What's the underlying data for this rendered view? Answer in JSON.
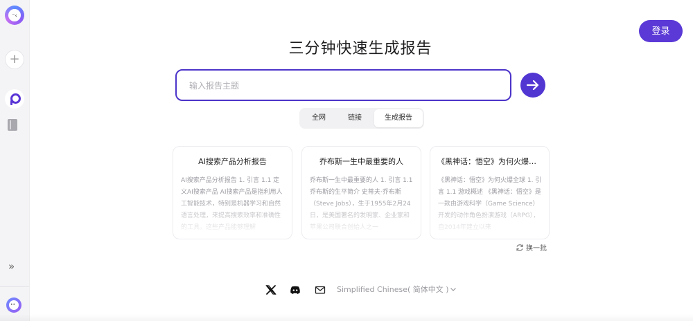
{
  "sidebar": {
    "logo_icon": "chat-logo-icon",
    "new_chat_icon": "plus-icon",
    "search_icon": "search-logo-icon",
    "library_icon": "book-icon",
    "expand_icon": "double-chevron-right-icon",
    "avatar_icon": "avatar-icon"
  },
  "header": {
    "login_label": "登录"
  },
  "main": {
    "title": "三分钟快速生成报告",
    "search": {
      "placeholder": "输入报告主题",
      "value": ""
    },
    "tabs": [
      {
        "label": "全网",
        "active": false
      },
      {
        "label": "链接",
        "active": false
      },
      {
        "label": "生成报告",
        "active": true
      }
    ],
    "cards": [
      {
        "title": "AI搜索产品分析报告",
        "body": "AI搜索产品分析报告 1. 引言 1.1 定义AI搜索产品 AI搜索产品是指利用人工智能技术，特别是机器学习和自然语言处理，来提高搜索效率和准确性的工具。这些产品能够理解"
      },
      {
        "title": "乔布斯一生中最重要的人",
        "body": "乔布斯一生中最重要的人 1. 引言 1.1 乔布斯的生平简介 史蒂夫·乔布斯（Steve Jobs），生于1955年2月24日，是美国著名的发明家、企业家和苹果公司联合创始人之一"
      },
      {
        "title": "《黑神话：悟空》为何火爆全球",
        "body": "《黑神话：悟空》为何火爆全球 1. 引言 1.1 游戏概述 《黑神话：悟空》是一款由游戏科学（Game Science）开发的动作角色扮演游戏（ARPG），自2014年建立以来"
      }
    ],
    "refresh_label": "换一批"
  },
  "footer": {
    "icons": [
      "x-twitter-icon",
      "discord-icon",
      "mail-icon"
    ],
    "language_label": "Simplified Chinese( 简体中文 )"
  },
  "colors": {
    "accent": "#5a39d6",
    "border_accent": "#4b34c9"
  }
}
